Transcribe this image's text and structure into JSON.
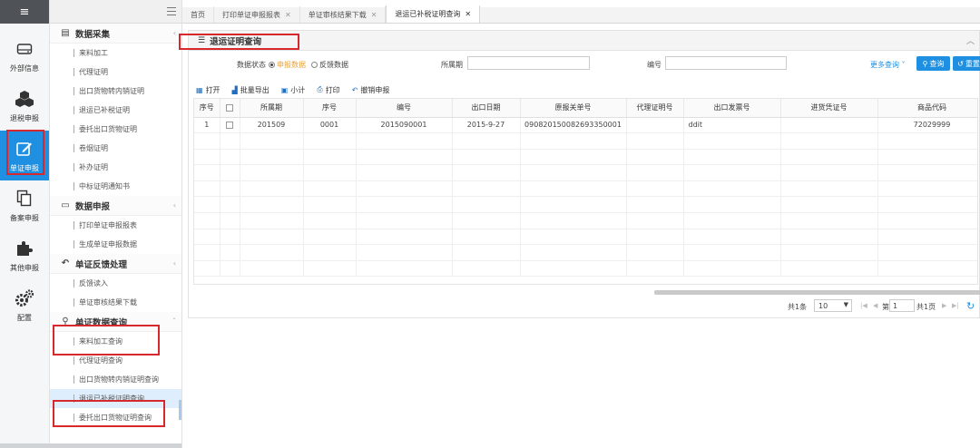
{
  "rail": {
    "menu_glyph": "≡",
    "items": [
      {
        "label": "外部信息",
        "icon": "drive-icon"
      },
      {
        "label": "退税申报",
        "icon": "cubes-icon"
      },
      {
        "label": "单证申报",
        "icon": "edit-icon",
        "active": true
      },
      {
        "label": "备案申报",
        "icon": "copy-icon"
      },
      {
        "label": "其他申报",
        "icon": "puzzle-icon"
      },
      {
        "label": "配置",
        "icon": "gears-icon"
      }
    ]
  },
  "sidebar": {
    "sections": [
      {
        "title": "数据采集",
        "icon": "doc-icon",
        "items": [
          "来料加工",
          "代理证明",
          "出口货物转内销证明",
          "退运已补税证明",
          "委托出口货物证明",
          "卷烟证明",
          "补办证明",
          "中标证明通知书"
        ]
      },
      {
        "title": "数据申报",
        "icon": "monitor-icon",
        "items": [
          "打印单证申报报表",
          "生成单证申报数据"
        ]
      },
      {
        "title": "单证反馈处理",
        "icon": "reply-icon",
        "items": [
          "反馈读入",
          "单证审核结果下载"
        ]
      },
      {
        "title": "单证数据查询",
        "icon": "search-icon",
        "items": [
          "来料加工查询",
          "代理证明查询",
          "出口货物转内销证明查询",
          "退运已补税证明查询",
          "委托出口货物证明查询"
        ]
      }
    ],
    "active_item": "退运已补税证明查询"
  },
  "tabs": [
    {
      "label": "首页",
      "closable": false
    },
    {
      "label": "打印单证申报报表",
      "closable": true
    },
    {
      "label": "单证审核结果下载",
      "closable": true
    },
    {
      "label": "退运已补税证明查询",
      "closable": true,
      "active": true
    }
  ],
  "panel": {
    "title": "退运证明查询",
    "filter": {
      "status_label": "数据状态",
      "option1": "申报数据",
      "option2": "反馈数据",
      "period_label": "所属期",
      "number_label": "编号",
      "more": "更多查询",
      "query_btn": "查询",
      "reset_btn": "重置"
    },
    "toolbar": [
      "打开",
      "批量导出",
      "小计",
      "打印",
      "撤销申报"
    ],
    "columns": [
      "序号",
      "",
      "所属期",
      "序号",
      "编号",
      "出口日期",
      "原报关单号",
      "代理证明号",
      "出口发票号",
      "进货凭证号",
      "商品代码"
    ],
    "rows": [
      [
        "1",
        "",
        "201509",
        "0001",
        "2015090001",
        "2015-9-27",
        "090820150082693350001",
        "",
        "ddit",
        "",
        "72029999"
      ]
    ],
    "pager": {
      "total": "共1条",
      "page_size": "10",
      "page_prefix": "第",
      "page_value": "1",
      "page_total": "共1页"
    }
  },
  "colors": {
    "accent": "#1e8fe1",
    "highlight_box": "#d6282d",
    "radio_active_text": "#e8a33d"
  }
}
